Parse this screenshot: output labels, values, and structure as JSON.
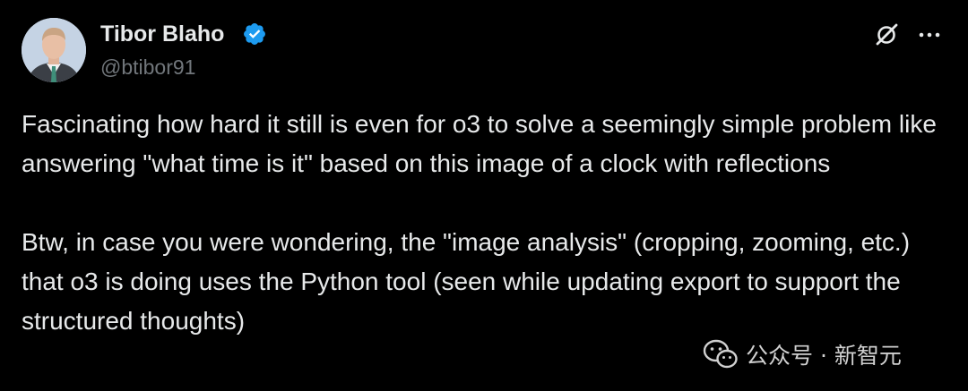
{
  "author": {
    "name": "Tibor Blaho",
    "handle": "@btibor91",
    "verified": true
  },
  "header_icons": [
    "grok-icon",
    "more-options-icon"
  ],
  "tweet": {
    "paragraphs": [
      "Fascinating how hard it still is even for o3 to solve a seemingly simple problem like answering \"what time is it\" based on this image of a clock with reflections",
      "Btw, in case you were wondering, the \"image analysis\" (cropping, zooming, etc.) that o3 is doing uses the Python tool (seen while updating export to support the structured thoughts)"
    ]
  },
  "watermark": {
    "text": "公众号 · 新智元",
    "icon": "wechat-icon"
  },
  "colors": {
    "background": "#000000",
    "text": "#e7e9ea",
    "secondary_text": "#71767b",
    "verified_badge": "#1d9bf0"
  }
}
